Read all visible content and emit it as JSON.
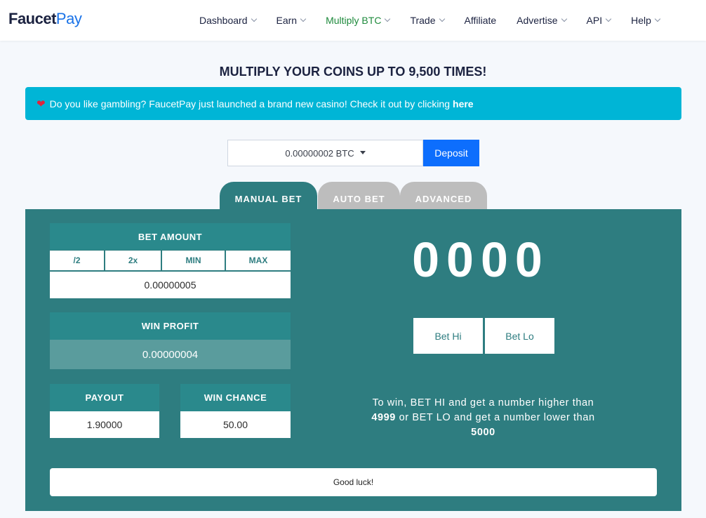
{
  "header": {
    "logo_part1": "Faucet",
    "logo_part2": "Pay",
    "nav": [
      {
        "label": "Dashboard"
      },
      {
        "label": "Earn"
      },
      {
        "label": "Multiply BTC"
      },
      {
        "label": "Trade"
      },
      {
        "label": "Affiliate"
      },
      {
        "label": "Advertise"
      },
      {
        "label": "API"
      },
      {
        "label": "Help"
      }
    ],
    "active_color": "#1e8a3c"
  },
  "page": {
    "title": "MULTIPLY YOUR COINS UP TO 9,500 TIMES!",
    "alert_text": "Do you like gambling? FaucetPay just launched a brand new casino! Check it out by clicking",
    "alert_link": "here",
    "alert_icon": "heart-icon"
  },
  "wallet": {
    "balance": "0.00000002 BTC",
    "deposit_label": "Deposit"
  },
  "tabs": [
    {
      "label": "MANUAL BET"
    },
    {
      "label": "AUTO BET"
    },
    {
      "label": "ADVANCED"
    }
  ],
  "bet": {
    "amount_label": "BET AMOUNT",
    "buttons": [
      "/2",
      "2x",
      "MIN",
      "MAX"
    ],
    "amount_value": "0.00000005",
    "profit_label": "WIN PROFIT",
    "profit_value": "0.00000004",
    "payout_label": "PAYOUT",
    "payout_value": "1.90000",
    "chance_label": "WIN CHANCE",
    "chance_value": "50.00"
  },
  "game": {
    "roll": "0000",
    "bet_hi": "Bet Hi",
    "bet_lo": "Bet Lo",
    "info_1": "To win, BET HI and get a number higher than",
    "hi_threshold": "4999",
    "info_2": "or BET LO and get a number lower than",
    "lo_threshold": "5000",
    "message": "Good luck!"
  },
  "colors": {
    "panel": "#2e7d80",
    "alert": "#00b5d6",
    "deposit": "#0d6efd"
  }
}
